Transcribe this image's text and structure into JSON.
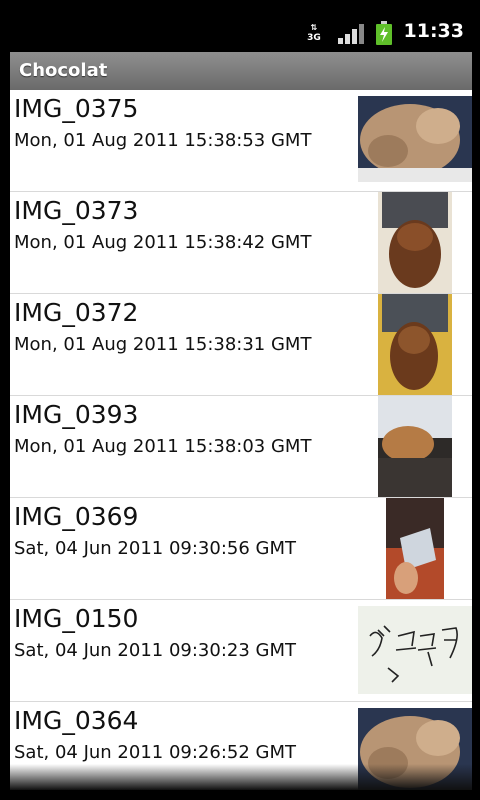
{
  "status": {
    "network": "3G",
    "time": "11:33"
  },
  "app": {
    "title": "Chocolat"
  },
  "images": [
    {
      "name": "IMG_0375",
      "date": "Mon, 01 Aug 2011 15:38:53 GMT"
    },
    {
      "name": "IMG_0373",
      "date": "Mon, 01 Aug 2011 15:38:42 GMT"
    },
    {
      "name": "IMG_0372",
      "date": "Mon, 01 Aug 2011 15:38:31 GMT"
    },
    {
      "name": "IMG_0393",
      "date": "Mon, 01 Aug 2011 15:38:03 GMT"
    },
    {
      "name": "IMG_0369",
      "date": "Sat, 04 Jun 2011 09:30:56 GMT"
    },
    {
      "name": "IMG_0150",
      "date": "Sat, 04 Jun 2011 09:30:23 GMT"
    },
    {
      "name": "IMG_0364",
      "date": "Sat, 04 Jun 2011 09:26:52 GMT"
    }
  ]
}
